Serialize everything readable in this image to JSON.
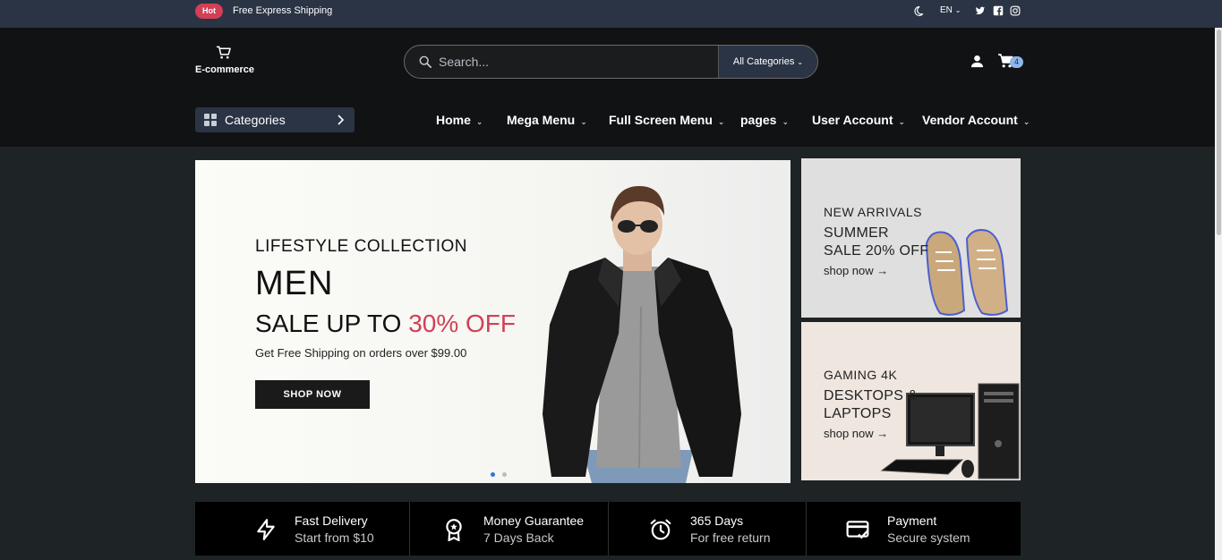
{
  "topbar": {
    "hot_badge": "Hot",
    "shipping_text": "Free Express Shipping",
    "language": "EN",
    "icons": [
      "moon-icon",
      "twitter-icon",
      "facebook-icon",
      "instagram-icon"
    ]
  },
  "header": {
    "logo_text": "E-commerce",
    "search_placeholder": "Search...",
    "category_select": "All Categories",
    "cart_count": "4"
  },
  "nav": {
    "categories_label": "Categories",
    "items": [
      "Home",
      "Mega Menu",
      "Full Screen Menu",
      "pages",
      "User Account",
      "Vendor Account"
    ]
  },
  "hero": {
    "subtitle": "LIFESTYLE COLLECTION",
    "title": "MEN",
    "sale_prefix": "SALE UP TO ",
    "sale_accent": "30% OFF",
    "shipping": "Get Free Shipping on orders over $99.00",
    "button": "SHOP NOW",
    "slides_total": 2,
    "active_slide": 1
  },
  "side_banners": [
    {
      "label": "NEW ARRIVALS",
      "title_line1": "SUMMER",
      "title_line2": "SALE 20% OFF",
      "link": "shop now →"
    },
    {
      "label": "GAMING 4K",
      "title_line1": "DESKTOPS &",
      "title_line2": "LAPTOPS",
      "link": "shop now →"
    }
  ],
  "services": [
    {
      "icon": "lightning-icon",
      "title": "Fast Delivery",
      "subtitle": "Start from $10"
    },
    {
      "icon": "award-icon",
      "title": "Money Guarantee",
      "subtitle": "7 Days Back"
    },
    {
      "icon": "alarm-clock-icon",
      "title": "365 Days",
      "subtitle": "For free return"
    },
    {
      "icon": "credit-card-check-icon",
      "title": "Payment",
      "subtitle": "Secure system"
    }
  ],
  "colors": {
    "accent": "#d23f57",
    "topbar": "#2b3445",
    "header": "#111213",
    "page": "#1e2325"
  }
}
